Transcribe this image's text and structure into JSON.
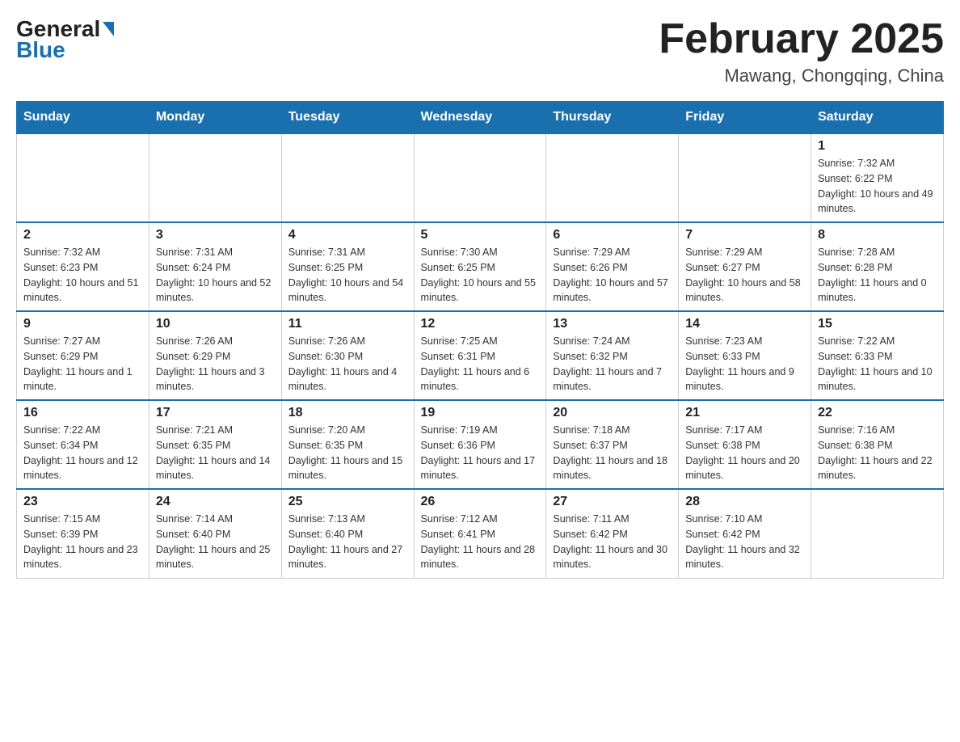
{
  "header": {
    "logo_general": "General",
    "logo_blue": "Blue",
    "month_title": "February 2025",
    "location": "Mawang, Chongqing, China"
  },
  "weekdays": [
    "Sunday",
    "Monday",
    "Tuesday",
    "Wednesday",
    "Thursday",
    "Friday",
    "Saturday"
  ],
  "weeks": [
    [
      {
        "day": "",
        "sunrise": "",
        "sunset": "",
        "daylight": ""
      },
      {
        "day": "",
        "sunrise": "",
        "sunset": "",
        "daylight": ""
      },
      {
        "day": "",
        "sunrise": "",
        "sunset": "",
        "daylight": ""
      },
      {
        "day": "",
        "sunrise": "",
        "sunset": "",
        "daylight": ""
      },
      {
        "day": "",
        "sunrise": "",
        "sunset": "",
        "daylight": ""
      },
      {
        "day": "",
        "sunrise": "",
        "sunset": "",
        "daylight": ""
      },
      {
        "day": "1",
        "sunrise": "Sunrise: 7:32 AM",
        "sunset": "Sunset: 6:22 PM",
        "daylight": "Daylight: 10 hours and 49 minutes."
      }
    ],
    [
      {
        "day": "2",
        "sunrise": "Sunrise: 7:32 AM",
        "sunset": "Sunset: 6:23 PM",
        "daylight": "Daylight: 10 hours and 51 minutes."
      },
      {
        "day": "3",
        "sunrise": "Sunrise: 7:31 AM",
        "sunset": "Sunset: 6:24 PM",
        "daylight": "Daylight: 10 hours and 52 minutes."
      },
      {
        "day": "4",
        "sunrise": "Sunrise: 7:31 AM",
        "sunset": "Sunset: 6:25 PM",
        "daylight": "Daylight: 10 hours and 54 minutes."
      },
      {
        "day": "5",
        "sunrise": "Sunrise: 7:30 AM",
        "sunset": "Sunset: 6:25 PM",
        "daylight": "Daylight: 10 hours and 55 minutes."
      },
      {
        "day": "6",
        "sunrise": "Sunrise: 7:29 AM",
        "sunset": "Sunset: 6:26 PM",
        "daylight": "Daylight: 10 hours and 57 minutes."
      },
      {
        "day": "7",
        "sunrise": "Sunrise: 7:29 AM",
        "sunset": "Sunset: 6:27 PM",
        "daylight": "Daylight: 10 hours and 58 minutes."
      },
      {
        "day": "8",
        "sunrise": "Sunrise: 7:28 AM",
        "sunset": "Sunset: 6:28 PM",
        "daylight": "Daylight: 11 hours and 0 minutes."
      }
    ],
    [
      {
        "day": "9",
        "sunrise": "Sunrise: 7:27 AM",
        "sunset": "Sunset: 6:29 PM",
        "daylight": "Daylight: 11 hours and 1 minute."
      },
      {
        "day": "10",
        "sunrise": "Sunrise: 7:26 AM",
        "sunset": "Sunset: 6:29 PM",
        "daylight": "Daylight: 11 hours and 3 minutes."
      },
      {
        "day": "11",
        "sunrise": "Sunrise: 7:26 AM",
        "sunset": "Sunset: 6:30 PM",
        "daylight": "Daylight: 11 hours and 4 minutes."
      },
      {
        "day": "12",
        "sunrise": "Sunrise: 7:25 AM",
        "sunset": "Sunset: 6:31 PM",
        "daylight": "Daylight: 11 hours and 6 minutes."
      },
      {
        "day": "13",
        "sunrise": "Sunrise: 7:24 AM",
        "sunset": "Sunset: 6:32 PM",
        "daylight": "Daylight: 11 hours and 7 minutes."
      },
      {
        "day": "14",
        "sunrise": "Sunrise: 7:23 AM",
        "sunset": "Sunset: 6:33 PM",
        "daylight": "Daylight: 11 hours and 9 minutes."
      },
      {
        "day": "15",
        "sunrise": "Sunrise: 7:22 AM",
        "sunset": "Sunset: 6:33 PM",
        "daylight": "Daylight: 11 hours and 10 minutes."
      }
    ],
    [
      {
        "day": "16",
        "sunrise": "Sunrise: 7:22 AM",
        "sunset": "Sunset: 6:34 PM",
        "daylight": "Daylight: 11 hours and 12 minutes."
      },
      {
        "day": "17",
        "sunrise": "Sunrise: 7:21 AM",
        "sunset": "Sunset: 6:35 PM",
        "daylight": "Daylight: 11 hours and 14 minutes."
      },
      {
        "day": "18",
        "sunrise": "Sunrise: 7:20 AM",
        "sunset": "Sunset: 6:35 PM",
        "daylight": "Daylight: 11 hours and 15 minutes."
      },
      {
        "day": "19",
        "sunrise": "Sunrise: 7:19 AM",
        "sunset": "Sunset: 6:36 PM",
        "daylight": "Daylight: 11 hours and 17 minutes."
      },
      {
        "day": "20",
        "sunrise": "Sunrise: 7:18 AM",
        "sunset": "Sunset: 6:37 PM",
        "daylight": "Daylight: 11 hours and 18 minutes."
      },
      {
        "day": "21",
        "sunrise": "Sunrise: 7:17 AM",
        "sunset": "Sunset: 6:38 PM",
        "daylight": "Daylight: 11 hours and 20 minutes."
      },
      {
        "day": "22",
        "sunrise": "Sunrise: 7:16 AM",
        "sunset": "Sunset: 6:38 PM",
        "daylight": "Daylight: 11 hours and 22 minutes."
      }
    ],
    [
      {
        "day": "23",
        "sunrise": "Sunrise: 7:15 AM",
        "sunset": "Sunset: 6:39 PM",
        "daylight": "Daylight: 11 hours and 23 minutes."
      },
      {
        "day": "24",
        "sunrise": "Sunrise: 7:14 AM",
        "sunset": "Sunset: 6:40 PM",
        "daylight": "Daylight: 11 hours and 25 minutes."
      },
      {
        "day": "25",
        "sunrise": "Sunrise: 7:13 AM",
        "sunset": "Sunset: 6:40 PM",
        "daylight": "Daylight: 11 hours and 27 minutes."
      },
      {
        "day": "26",
        "sunrise": "Sunrise: 7:12 AM",
        "sunset": "Sunset: 6:41 PM",
        "daylight": "Daylight: 11 hours and 28 minutes."
      },
      {
        "day": "27",
        "sunrise": "Sunrise: 7:11 AM",
        "sunset": "Sunset: 6:42 PM",
        "daylight": "Daylight: 11 hours and 30 minutes."
      },
      {
        "day": "28",
        "sunrise": "Sunrise: 7:10 AM",
        "sunset": "Sunset: 6:42 PM",
        "daylight": "Daylight: 11 hours and 32 minutes."
      },
      {
        "day": "",
        "sunrise": "",
        "sunset": "",
        "daylight": ""
      }
    ]
  ]
}
